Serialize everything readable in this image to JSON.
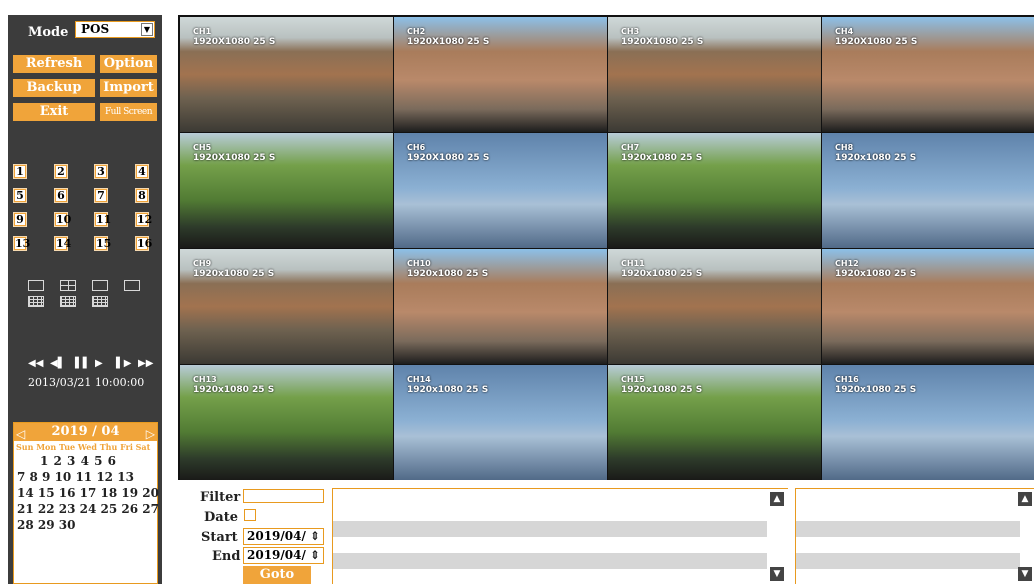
{
  "sidebar": {
    "mode_label": "Mode",
    "mode_value": "POS",
    "buttons": {
      "refresh": "Refresh",
      "option": "Option",
      "backup": "Backup",
      "import": "Import",
      "exit": "Exit",
      "fullscreen": "Full Screen"
    },
    "channels": [
      "1",
      "2",
      "3",
      "4",
      "5",
      "6",
      "7",
      "8",
      "9",
      "10",
      "11",
      "12",
      "13",
      "14",
      "15",
      "16"
    ],
    "layout_icons": [
      "layout-1x1-icon",
      "layout-2x2-icon",
      "layout-1plus5-icon",
      "layout-1plus7-icon",
      "layout-3x3-icon",
      "layout-4x4-alt-icon",
      "layout-4x4-icon"
    ],
    "playback": {
      "controls": [
        "◀◀",
        "◀▌",
        "▌▌",
        "▶",
        "▌▶",
        "▶▶"
      ],
      "time": "2013/03/21 10:00:00"
    },
    "calendar": {
      "month": "2019 / 04",
      "dow": "Sun Mon Tue Wed Thu Fri Sat",
      "rows": [
        "      1  2  3  4  5  6",
        "7  8  9 10 11 12 13",
        "14 15 16 17 18 19 20",
        "21 22 23 24 25 26 27",
        "28 29 30"
      ]
    }
  },
  "tiles": [
    {
      "ch": "CH1",
      "res": "1920X1080 25 S",
      "scene": "city"
    },
    {
      "ch": "CH2",
      "res": "1920X1080 25 S",
      "scene": "mosque"
    },
    {
      "ch": "CH3",
      "res": "1920X1080 25 S",
      "scene": "city"
    },
    {
      "ch": "CH4",
      "res": "1920X1080 25 S",
      "scene": "mosque"
    },
    {
      "ch": "CH5",
      "res": "1920X1080 25 S",
      "scene": "garden"
    },
    {
      "ch": "CH6",
      "res": "1920X1080 25 S",
      "scene": "sky"
    },
    {
      "ch": "CH7",
      "res": "1920x1080 25 S",
      "scene": "garden"
    },
    {
      "ch": "CH8",
      "res": "1920x1080 25 S",
      "scene": "sky"
    },
    {
      "ch": "CH9",
      "res": "1920x1080 25 S",
      "scene": "city"
    },
    {
      "ch": "CH10",
      "res": "1920x1080 25 S",
      "scene": "mosque"
    },
    {
      "ch": "CH11",
      "res": "1920x1080 25 S",
      "scene": "city"
    },
    {
      "ch": "CH12",
      "res": "1920x1080 25 S",
      "scene": "mosque"
    },
    {
      "ch": "CH13",
      "res": "1920x1080 25 S",
      "scene": "garden"
    },
    {
      "ch": "CH14",
      "res": "1920x1080 25 S",
      "scene": "sky"
    },
    {
      "ch": "CH15",
      "res": "1920x1080 25 S",
      "scene": "garden"
    },
    {
      "ch": "CH16",
      "res": "1920x1080 25 S",
      "scene": "sky"
    }
  ],
  "search": {
    "filter_label": "Filter",
    "filter_value": "",
    "date_label": "Date",
    "start_label": "Start",
    "start_value": "2019/04/",
    "end_label": "End",
    "end_value": "2019/04/",
    "goto_label": "Goto"
  }
}
